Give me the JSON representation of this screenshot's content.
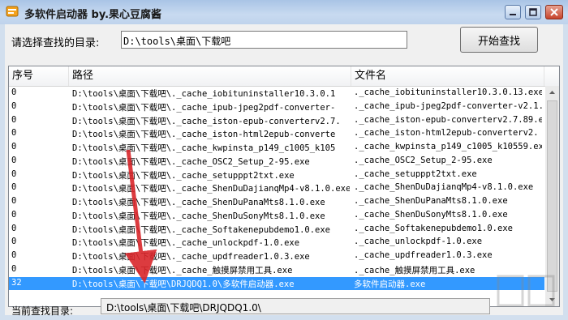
{
  "window": {
    "title": "多软件启动器 by.果心豆腐酱",
    "icon": "app-icon",
    "controls": [
      "minimize-icon",
      "maximize-icon",
      "close-icon"
    ]
  },
  "toolbar": {
    "dir_label": "请选择查找的目录:",
    "dir_value": "D:\\tools\\桌面\\下载吧",
    "start_label": "开始查找"
  },
  "list": {
    "headers": {
      "seq": "序号",
      "path": "路径",
      "name": "文件名"
    },
    "rows": [
      {
        "seq": "0",
        "path": "D:\\tools\\桌面\\下载吧\\._cache_iobituninstaller10.3.0.1",
        "name": "._cache_iobituninstaller10.3.0.13.exe"
      },
      {
        "seq": "0",
        "path": "D:\\tools\\桌面\\下载吧\\._cache_ipub-jpeg2pdf-converter-",
        "name": "._cache_ipub-jpeg2pdf-converter-v2.1."
      },
      {
        "seq": "0",
        "path": "D:\\tools\\桌面\\下载吧\\._cache_iston-epub-converterv2.7.",
        "name": "._cache_iston-epub-converterv2.7.89.ex"
      },
      {
        "seq": "0",
        "path": "D:\\tools\\桌面\\下载吧\\._cache_iston-html2epub-converte",
        "name": "._cache_iston-html2epub-converterv2."
      },
      {
        "seq": "0",
        "path": "D:\\tools\\桌面\\下载吧\\._cache_kwpinsta_p149_c1005_k105",
        "name": "._cache_kwpinsta_p149_c1005_k10559.exe"
      },
      {
        "seq": "0",
        "path": "D:\\tools\\桌面\\下载吧\\._cache_OSC2_Setup_2-95.exe",
        "name": "._cache_OSC2_Setup_2-95.exe"
      },
      {
        "seq": "0",
        "path": "D:\\tools\\桌面\\下载吧\\._cache_setupppt2txt.exe",
        "name": "._cache_setupppt2txt.exe"
      },
      {
        "seq": "0",
        "path": "D:\\tools\\桌面\\下载吧\\._cache_ShenDuDajianqMp4-v8.1.0.exe",
        "name": "._cache_ShenDuDajianqMp4-v8.1.0.exe"
      },
      {
        "seq": "0",
        "path": "D:\\tools\\桌面\\下载吧\\._cache_ShenDuPanaMts8.1.0.exe",
        "name": "._cache_ShenDuPanaMts8.1.0.exe"
      },
      {
        "seq": "0",
        "path": "D:\\tools\\桌面\\下载吧\\._cache_ShenDuSonyMts8.1.0.exe",
        "name": "._cache_ShenDuSonyMts8.1.0.exe"
      },
      {
        "seq": "0",
        "path": "D:\\tools\\桌面\\下载吧\\._cache_Softakenepubdemo1.0.exe",
        "name": "._cache_Softakenepubdemo1.0.exe"
      },
      {
        "seq": "0",
        "path": "D:\\tools\\桌面\\下载吧\\._cache_unlockpdf-1.0.exe",
        "name": "._cache_unlockpdf-1.0.exe"
      },
      {
        "seq": "0",
        "path": "D:\\tools\\桌面\\下载吧\\._cache_updfreader1.0.3.exe",
        "name": "._cache_updfreader1.0.3.exe"
      },
      {
        "seq": "0",
        "path": "D:\\tools\\桌面\\下载吧\\._cache_触摸屏禁用工具.exe",
        "name": "._cache_触摸屏禁用工具.exe"
      },
      {
        "seq": "32",
        "path": "D:\\tools\\桌面\\下载吧\\DRJQDQ1.0\\多软件启动器.exe",
        "name": "多软件启动器.exe",
        "selected": true
      }
    ]
  },
  "status": {
    "label": "当前查找目录:",
    "value": "D:\\tools\\桌面\\下载吧\\DRJQDQ1.0\\"
  },
  "colors": {
    "selection": "#3399ff",
    "annotation_arrow": "#d9262b"
  }
}
